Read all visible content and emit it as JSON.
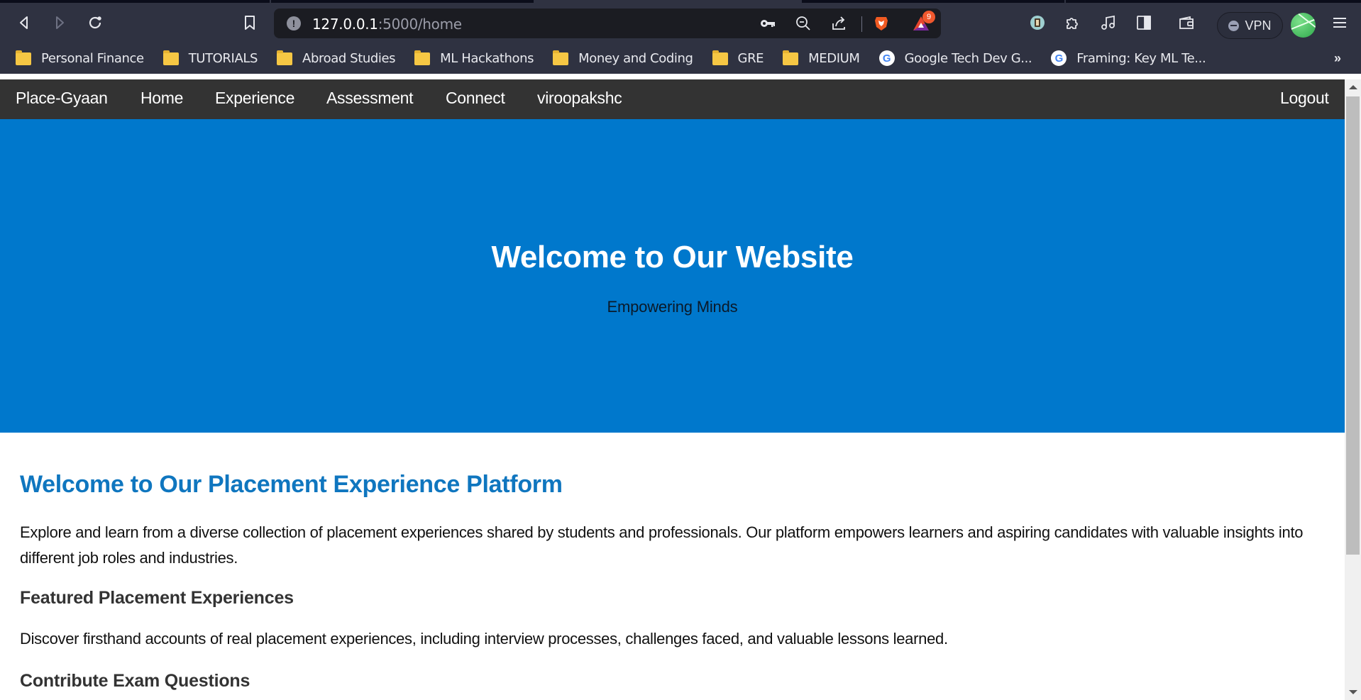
{
  "browser": {
    "url_host": "127.0.0.1",
    "url_rest": ":5000/home",
    "rewards_badge": "9",
    "vpn_label": "VPN",
    "bookmarks": [
      {
        "label": "Personal Finance",
        "icon": "folder-icon"
      },
      {
        "label": "TUTORIALS",
        "icon": "folder-icon"
      },
      {
        "label": "Abroad Studies",
        "icon": "folder-icon"
      },
      {
        "label": "ML Hackathons",
        "icon": "folder-icon"
      },
      {
        "label": "Money and Coding",
        "icon": "folder-icon"
      },
      {
        "label": "GRE",
        "icon": "folder-icon"
      },
      {
        "label": "MEDIUM",
        "icon": "folder-icon"
      },
      {
        "label": "Google Tech Dev G...",
        "icon": "google-icon"
      },
      {
        "label": "Framing: Key ML Te...",
        "icon": "google-icon"
      }
    ],
    "bookmarks_overflow": "»",
    "colors": {
      "chrome_bg": "#2f3241",
      "urlbar_bg": "#1b1c22"
    }
  },
  "site": {
    "nav": {
      "brand": "Place-Gyaan",
      "links": [
        "Home",
        "Experience",
        "Assessment",
        "Connect",
        "viroopakshc"
      ],
      "logout": "Logout"
    },
    "hero": {
      "title": "Welcome to Our Website",
      "subtitle": "Empowering Minds"
    },
    "content": {
      "heading": "Welcome to Our Placement Experience Platform",
      "intro": "Explore and learn from a diverse collection of placement experiences shared by students and professionals. Our platform empowers learners and aspiring candidates with valuable insights into different job roles and industries.",
      "sections": [
        {
          "title": "Featured Placement Experiences",
          "text": "Discover firsthand accounts of real placement experiences, including interview processes, challenges faced, and valuable lessons learned."
        },
        {
          "title": "Contribute Exam Questions"
        }
      ]
    },
    "colors": {
      "nav_bg": "#333333",
      "hero_bg": "#0078cc",
      "heading": "#0f76bf"
    }
  }
}
